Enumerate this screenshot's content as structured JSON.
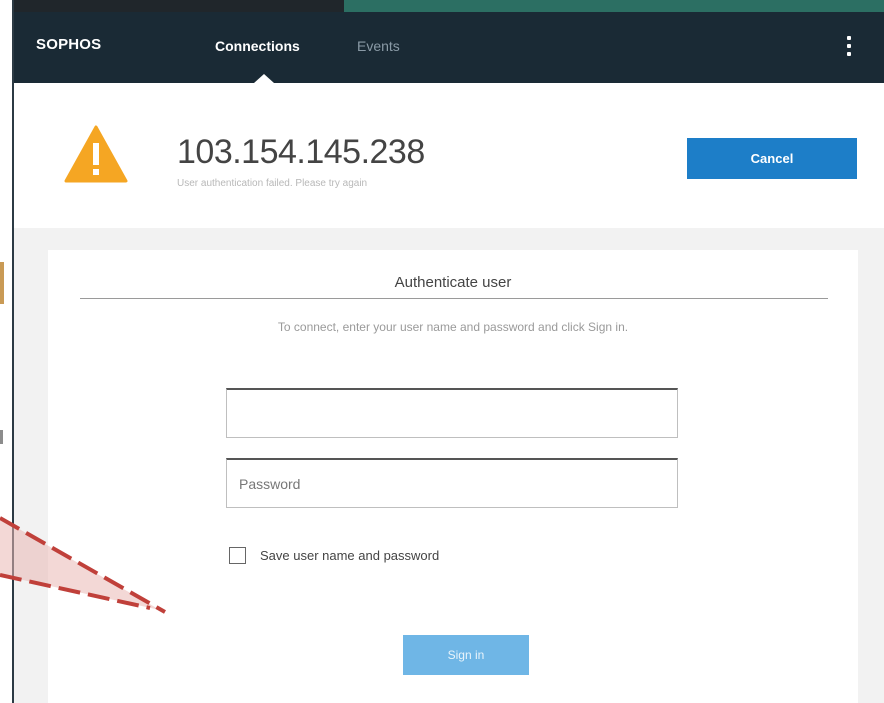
{
  "navbar": {
    "logo": "SOPHOS",
    "tabs": [
      {
        "label": "Connections",
        "active": true
      },
      {
        "label": "Events",
        "active": false
      }
    ],
    "menu_icon": "kebab-menu-icon"
  },
  "status": {
    "icon": "warning-icon",
    "ip_address": "103.154.145.238",
    "message": "User authentication failed. Please try again",
    "cancel_label": "Cancel"
  },
  "auth": {
    "title": "Authenticate user",
    "instructions": "To connect, enter your user name and password and click Sign in.",
    "username": {
      "value": "",
      "placeholder": ""
    },
    "password": {
      "value": "",
      "placeholder": "Password"
    },
    "save_label": "Save user name and password",
    "save_checked": false,
    "signin_label": "Sign in"
  },
  "colors": {
    "navbar_bg": "#1a2a35",
    "accent_blue": "#1d7ec8",
    "signin_disabled": "#6fb6e6",
    "warning_orange": "#f5a623",
    "annotation_red": "#c0403a"
  }
}
